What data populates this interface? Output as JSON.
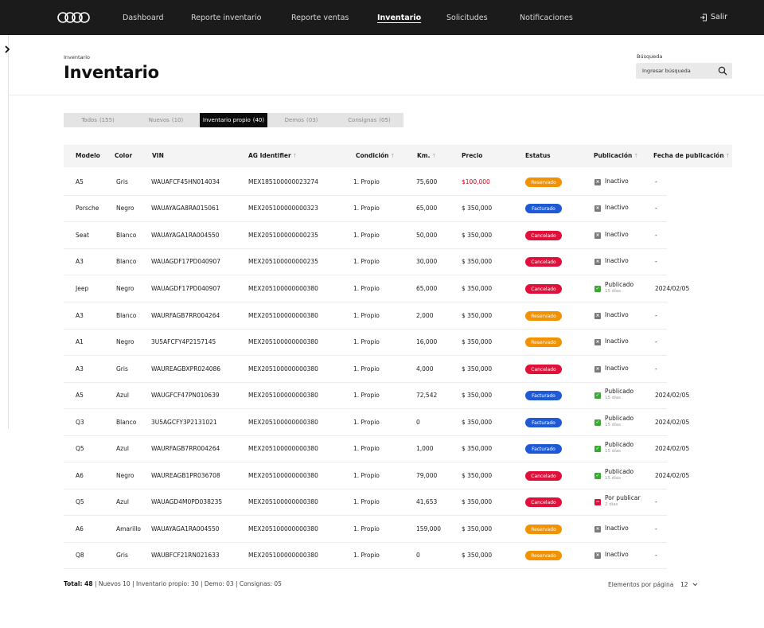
{
  "nav": {
    "items": [
      {
        "label": "Dashboard",
        "active": false
      },
      {
        "label": "Reporte inventario",
        "active": false
      },
      {
        "label": "Reporte ventas",
        "active": false
      },
      {
        "label": "Inventario",
        "active": true
      },
      {
        "label": "Solicitudes",
        "active": false
      },
      {
        "label": "Notificaciones",
        "active": false
      }
    ],
    "logout_label": "Salir",
    "logo_icon": "four-rings-logo",
    "logout_icon": "logout-icon"
  },
  "header": {
    "breadcrumb": "Inventario",
    "title": "Inventario",
    "search_label": "Búsqueda",
    "search_placeholder": "Ingresar búsqueda"
  },
  "tabs": [
    {
      "label": "Todos",
      "count": "(155)",
      "active": false
    },
    {
      "label": "Nuevos",
      "count": "(10)",
      "active": false
    },
    {
      "label": "Inventario propio",
      "count": "(40)",
      "active": true
    },
    {
      "label": "Demos",
      "count": "(03)",
      "active": false
    },
    {
      "label": "Consignas",
      "count": "(05)",
      "active": false
    }
  ],
  "columns": [
    {
      "label": "Modelo",
      "sortable": false
    },
    {
      "label": "Color",
      "sortable": false
    },
    {
      "label": "VIN",
      "sortable": false
    },
    {
      "label": "AG Identifier",
      "sortable": true
    },
    {
      "label": "Condición",
      "sortable": true
    },
    {
      "label": "Km.",
      "sortable": true
    },
    {
      "label": "Precio",
      "sortable": false
    },
    {
      "label": "Estatus",
      "sortable": false
    },
    {
      "label": "Publicación",
      "sortable": true
    },
    {
      "label": "Fecha de publicación",
      "sortable": true
    }
  ],
  "status_colors": {
    "Reservado": "#f39200",
    "Facturado": "#1f5ad6",
    "Cancelado": "#e0103a"
  },
  "publication_colors": {
    "Inactivo": "#7a7a7a",
    "Publicado": "#3aaa35",
    "Por publicar": "#e0103a"
  },
  "rows": [
    {
      "model": "A5",
      "color": "Gris",
      "vin": "WAUAFCF45HN014034",
      "ag_id": "MEX185100000023274",
      "condition": "1. Propio",
      "km": "75,600",
      "price": "$100,000",
      "price_alert": true,
      "status": "Reservado",
      "publication": "Inactivo",
      "publication_note": "",
      "pub_date": "-"
    },
    {
      "model": "Porsche",
      "color": "Negro",
      "vin": "WAUAYAGA8RA015061",
      "ag_id": "MEX205100000000323",
      "condition": "1. Propio",
      "km": "65,000",
      "price": "$ 350,000",
      "price_alert": false,
      "status": "Facturado",
      "publication": "Inactivo",
      "publication_note": "",
      "pub_date": "-"
    },
    {
      "model": "Seat",
      "color": "Blanco",
      "vin": "WAUAYAGA1RA004550",
      "ag_id": "MEX205100000000235",
      "condition": "1. Propio",
      "km": "50,000",
      "price": "$ 350,000",
      "price_alert": false,
      "status": "Cancelado",
      "publication": "Inactivo",
      "publication_note": "",
      "pub_date": "-"
    },
    {
      "model": "A3",
      "color": "Blanco",
      "vin": "WAUAGDF17PD040907",
      "ag_id": "MEX205100000000235",
      "condition": "1. Propio",
      "km": "30,000",
      "price": "$ 350,000",
      "price_alert": false,
      "status": "Cancelado",
      "publication": "Inactivo",
      "publication_note": "",
      "pub_date": "-"
    },
    {
      "model": "Jeep",
      "color": "Negro",
      "vin": "WAUAGDF17PD040907",
      "ag_id": "MEX205100000000380",
      "condition": "1. Propio",
      "km": "65,000",
      "price": "$ 350,000",
      "price_alert": false,
      "status": "Cancelado",
      "publication": "Publicado",
      "publication_note": "15 días",
      "pub_date": "2024/02/05"
    },
    {
      "model": "A3",
      "color": "Blanco",
      "vin": "WAURFAGB7RR004264",
      "ag_id": "MEX205100000000380",
      "condition": "1. Propio",
      "km": "2,000",
      "price": "$ 350,000",
      "price_alert": false,
      "status": "Reservado",
      "publication": "Inactivo",
      "publication_note": "",
      "pub_date": "-"
    },
    {
      "model": "A1",
      "color": "Negro",
      "vin": "3U5AFCFY4P2157145",
      "ag_id": "MEX205100000000380",
      "condition": "1. Propio",
      "km": "16,000",
      "price": "$ 350,000",
      "price_alert": false,
      "status": "Reservado",
      "publication": "Inactivo",
      "publication_note": "",
      "pub_date": "-"
    },
    {
      "model": "A3",
      "color": "Gris",
      "vin": "WAUREAGBXPR024086",
      "ag_id": "MEX205100000000380",
      "condition": "1. Propio",
      "km": "4,000",
      "price": "$ 350,000",
      "price_alert": false,
      "status": "Cancelado",
      "publication": "Inactivo",
      "publication_note": "",
      "pub_date": "-"
    },
    {
      "model": "A5",
      "color": "Azul",
      "vin": "WAUGFCF47PN010639",
      "ag_id": "MEX205100000000380",
      "condition": "1. Propio",
      "km": "72,542",
      "price": "$ 350,000",
      "price_alert": false,
      "status": "Facturado",
      "publication": "Publicado",
      "publication_note": "15 días",
      "pub_date": "2024/02/05"
    },
    {
      "model": "Q3",
      "color": "Blanco",
      "vin": "3U5AGCFY3P2131021",
      "ag_id": "MEX205100000000380",
      "condition": "1. Propio",
      "km": "0",
      "price": "$ 350,000",
      "price_alert": false,
      "status": "Facturado",
      "publication": "Publicado",
      "publication_note": "15 días",
      "pub_date": "2024/02/05"
    },
    {
      "model": "Q5",
      "color": "Azul",
      "vin": "WAURFAGB7RR004264",
      "ag_id": "MEX205100000000380",
      "condition": "1. Propio",
      "km": "1,000",
      "price": "$ 350,000",
      "price_alert": false,
      "status": "Facturado",
      "publication": "Publicado",
      "publication_note": "15 días",
      "pub_date": "2024/02/05"
    },
    {
      "model": "A6",
      "color": "Negro",
      "vin": "WAUREAGB1PR036708",
      "ag_id": "MEX205100000000380",
      "condition": "1. Propio",
      "km": "79,000",
      "price": "$ 350,000",
      "price_alert": false,
      "status": "Cancelado",
      "publication": "Publicado",
      "publication_note": "15 días",
      "pub_date": "2024/02/05"
    },
    {
      "model": "Q5",
      "color": "Azul",
      "vin": "WAUAGD4M0PD038235",
      "ag_id": "MEX205100000000380",
      "condition": "1. Propio",
      "km": "41,653",
      "price": "$ 350,000",
      "price_alert": false,
      "status": "Cancelado",
      "publication": "Por publicar",
      "publication_note": "2 días",
      "pub_date": "-"
    },
    {
      "model": "A6",
      "color": "Amarillo",
      "vin": "WAUAYAGA1RA004550",
      "ag_id": "MEX205100000000380",
      "condition": "1. Propio",
      "km": "159,000",
      "price": "$ 350,000",
      "price_alert": false,
      "status": "Reservado",
      "publication": "Inactivo",
      "publication_note": "",
      "pub_date": "-"
    },
    {
      "model": "Q8",
      "color": "Gris",
      "vin": "WAUBFCF21RN021633",
      "ag_id": "MEX205100000000380",
      "condition": "1. Propio",
      "km": "0",
      "price": "$ 350,000",
      "price_alert": false,
      "status": "Reservado",
      "publication": "Inactivo",
      "publication_note": "",
      "pub_date": "-"
    }
  ],
  "footer": {
    "total_label": "Total: 48",
    "summary": "| Nuevos 10 | Inventario propio: 30 | Demo: 03 | Consignas: 05",
    "per_page_label": "Elementos por página",
    "per_page_value": "12"
  }
}
